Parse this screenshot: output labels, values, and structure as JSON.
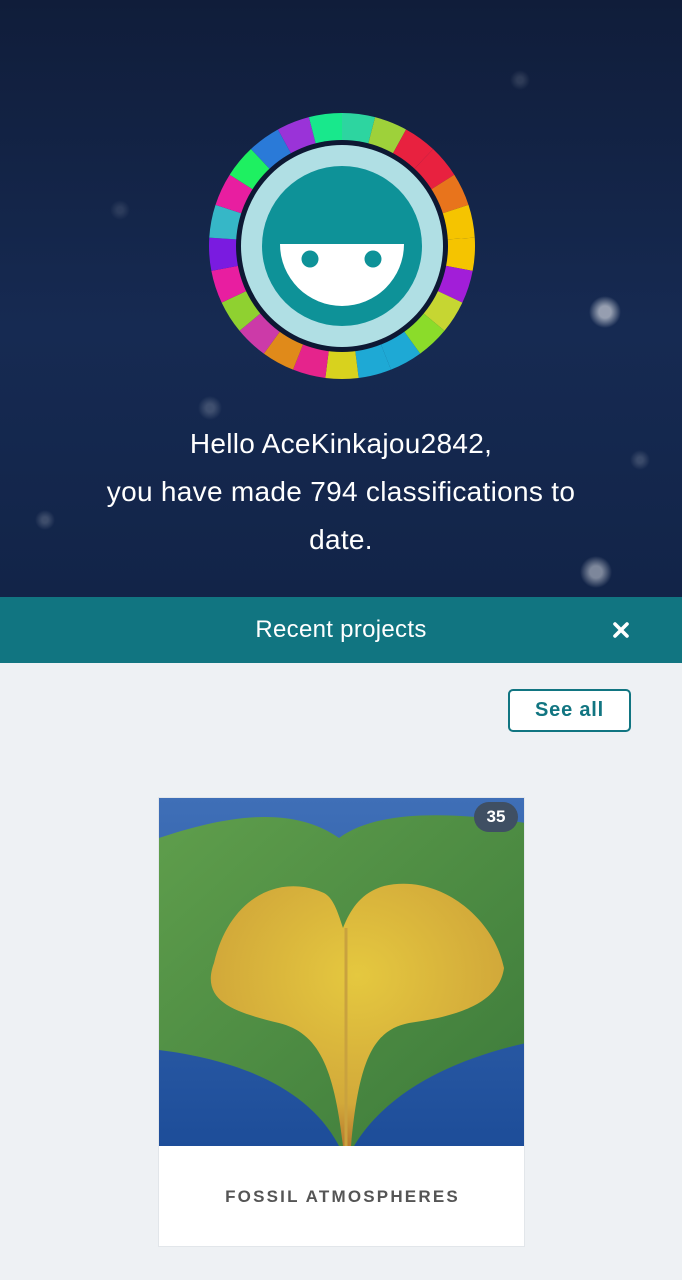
{
  "greeting": {
    "line1": "Hello AceKinkajou2842,",
    "line2": "you have made 794 classifications to",
    "line3": "date."
  },
  "recent_projects": {
    "title": "Recent projects",
    "close_icon": "close-icon",
    "see_all_label": "See all"
  },
  "projects": [
    {
      "name": "FOSSIL ATMOSPHERES",
      "count": "35"
    }
  ],
  "colors": {
    "accent": "#117581",
    "hero_bg": "#13244a",
    "avatar_face": "#0e9298",
    "avatar_ring": "#b0dfe4"
  }
}
